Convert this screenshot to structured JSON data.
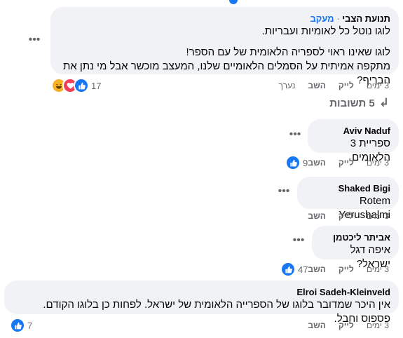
{
  "comments": [
    {
      "author": "תנועת הצבי",
      "follow_label": "מעקב",
      "lines": [
        "לוגו נוטל כל לאומיות ועבריות.",
        "",
        "לוגו שאינו ראוי לספריה הלאומית של עם הספר!",
        "מתקפה אמיתית על הסמלים הלאומיים שלנו, המעצב מוכשר אבל מי נתן את הבריף?"
      ],
      "time": "3 ימים",
      "like_label": "לייק",
      "reply_label": "השב",
      "edited_label": "נערך",
      "reaction_count": "17",
      "reactions": [
        "like-icon",
        "love-icon",
        "haha-icon"
      ]
    },
    {
      "author": "Aviv Naduf",
      "text": "ספריית 3 הלאומים",
      "time": "3 ימים",
      "like_label": "לייק",
      "reply_label": "השב",
      "reaction_count": "9"
    },
    {
      "author": "Shaked Bigi",
      "text": "Rotem Yerushalmi",
      "time": "3 ימים",
      "like_label": "לייק",
      "reply_label": "השב"
    },
    {
      "author": "אביתר ליכטמן",
      "text": "איפה דגל ישראל?",
      "time": "3 ימים",
      "like_label": "לייק",
      "reply_label": "השב",
      "reaction_count": "47"
    },
    {
      "author": "Elroi Sadeh-Kleinveld",
      "text": "אין היכר שמדובר בלוגו של הספרייה הלאומית של ישראל. לפחות כן בלוגו הקודם. פספוס וחבל.",
      "time": "3 ימים",
      "like_label": "לייק",
      "reply_label": "השב",
      "reaction_count": "7"
    }
  ],
  "replies_toggle": {
    "label": "5 תשובות",
    "icon": "reply-arrow-icon"
  },
  "colors": {
    "bubble": "#f0f2f5",
    "like_blue": "#1877f2",
    "love_red": "#f33e58",
    "haha_yellow": "#f7b125",
    "secondary_text": "#65676b"
  }
}
